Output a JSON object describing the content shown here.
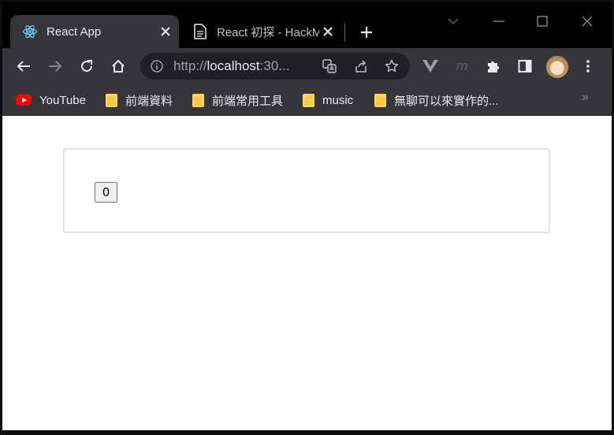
{
  "tabs": [
    {
      "title": "React App",
      "favicon": "react-icon",
      "active": true
    },
    {
      "title": "React 初探 - HackMD",
      "favicon": "document-icon",
      "active": false
    }
  ],
  "toolbar": {
    "url_scheme": "http://",
    "url_host": "localhost",
    "url_rest": ":30..."
  },
  "bookmarks": [
    {
      "label": "YouTube",
      "icon": "youtube-icon"
    },
    {
      "label": "前端資料",
      "icon": "folder-icon"
    },
    {
      "label": "前端常用工具",
      "icon": "folder-icon"
    },
    {
      "label": "music",
      "icon": "folder-icon"
    },
    {
      "label": "無聊可以來實作的...",
      "icon": "folder-icon"
    }
  ],
  "bookmarks_overflow": "»",
  "page": {
    "counter_value": "0"
  },
  "colors": {
    "tab_active_bg": "#35363a",
    "titlebar_bg": "#000000",
    "page_bg": "#ffffff",
    "card_border": "#e2e2e2",
    "react_blue": "#61dafb"
  }
}
